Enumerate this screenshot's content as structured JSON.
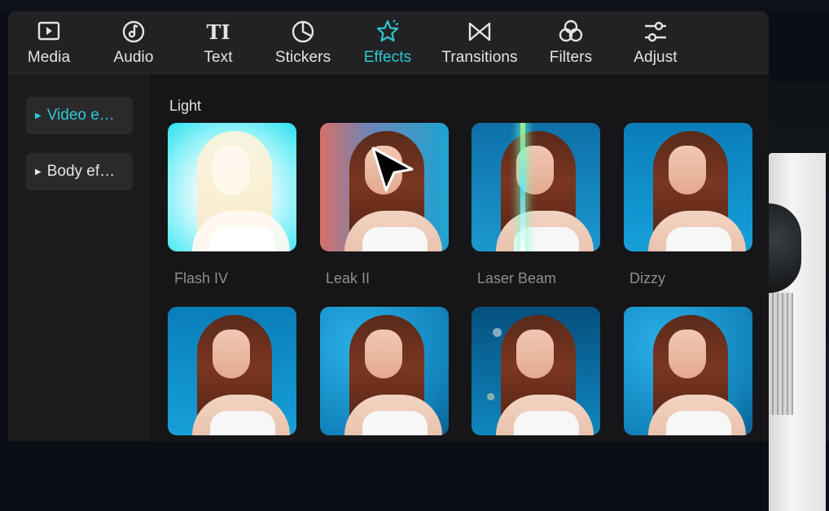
{
  "toolbar": {
    "tabs": [
      {
        "label": "Media",
        "icon": "media-icon"
      },
      {
        "label": "Audio",
        "icon": "audio-icon"
      },
      {
        "label": "Text",
        "icon": "text-icon"
      },
      {
        "label": "Stickers",
        "icon": "stickers-icon"
      },
      {
        "label": "Effects",
        "icon": "effects-icon",
        "active": true
      },
      {
        "label": "Transitions",
        "icon": "transitions-icon"
      },
      {
        "label": "Filters",
        "icon": "filters-icon"
      },
      {
        "label": "Adjust",
        "icon": "adjust-icon"
      }
    ],
    "icon_glyphs": {
      "text": "TI"
    },
    "accent_color": "#2cc8d6"
  },
  "sidebar": {
    "items": [
      {
        "label": "Video e…",
        "active": true
      },
      {
        "label": "Body ef…",
        "active": false
      }
    ]
  },
  "content": {
    "section_title": "Light",
    "effects": [
      {
        "label": "Flash IV"
      },
      {
        "label": "Leak II"
      },
      {
        "label": "Laser Beam"
      },
      {
        "label": "Dizzy"
      },
      {
        "label": ""
      },
      {
        "label": ""
      },
      {
        "label": ""
      },
      {
        "label": ""
      }
    ]
  }
}
